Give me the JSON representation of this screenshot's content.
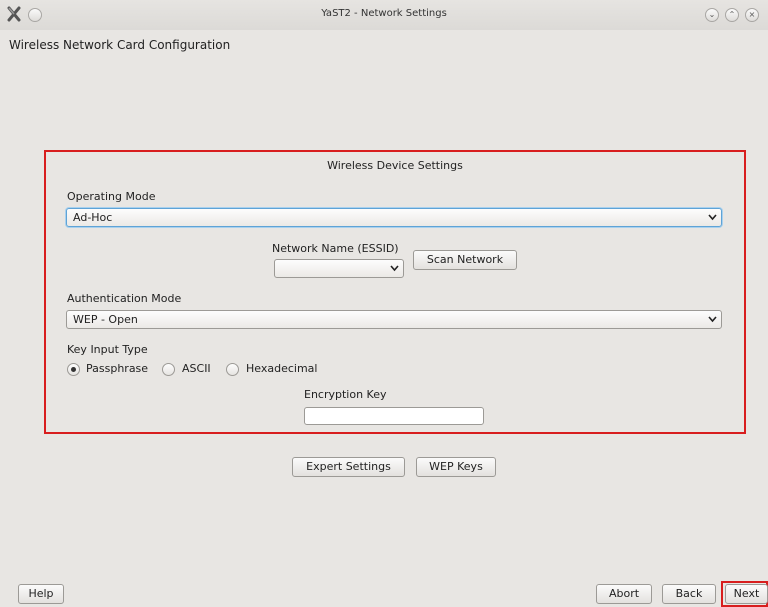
{
  "window": {
    "title": "YaST2 - Network Settings",
    "controls": [
      "minimize-icon",
      "maximize-icon",
      "close-icon"
    ]
  },
  "page": {
    "heading": "Wireless Network Card Configuration"
  },
  "wireless": {
    "section_title": "Wireless Device Settings",
    "operating_mode": {
      "label": "Operating Mode",
      "value": "Ad-Hoc"
    },
    "network_name": {
      "label": "Network Name (ESSID)",
      "value": "",
      "scan_button": "Scan Network"
    },
    "auth_mode": {
      "label": "Authentication Mode",
      "value": "WEP - Open"
    },
    "key_input": {
      "label": "Key Input Type",
      "options": [
        "Passphrase",
        "ASCII",
        "Hexadecimal"
      ],
      "selected": "Passphrase"
    },
    "encryption_key": {
      "label": "Encryption Key",
      "value": ""
    }
  },
  "extra_buttons": {
    "expert": "Expert Settings",
    "wep_keys": "WEP Keys"
  },
  "footer": {
    "help": "Help",
    "abort": "Abort",
    "back": "Back",
    "next": "Next"
  }
}
